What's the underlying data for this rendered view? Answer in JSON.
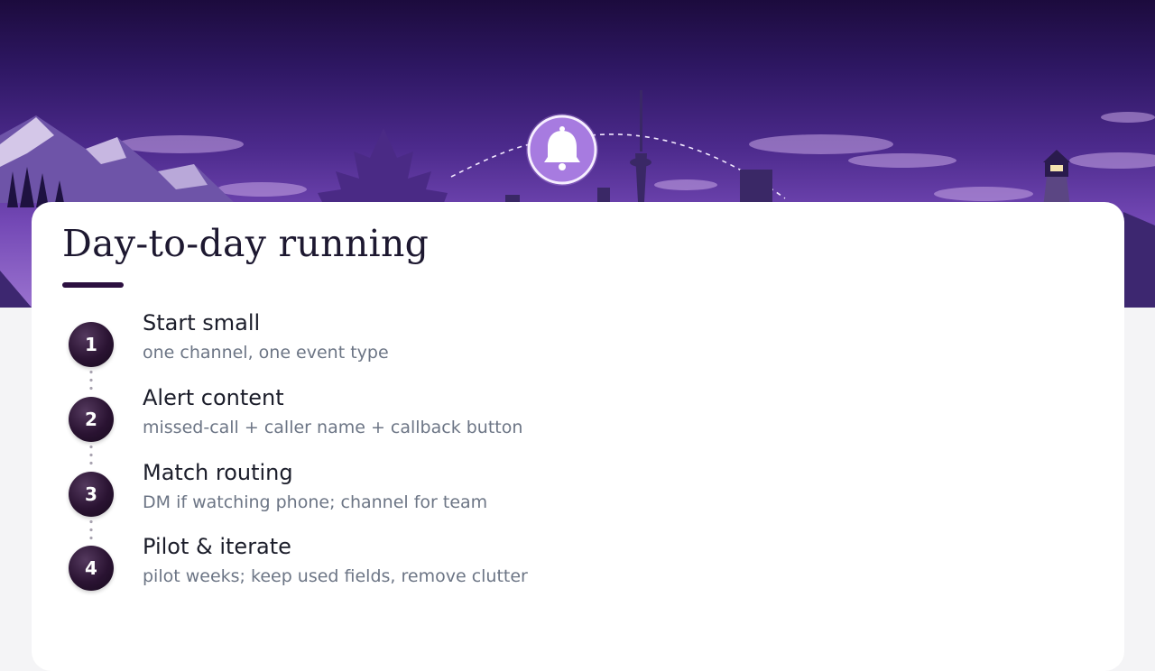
{
  "slide": {
    "title": "Day-to-day running",
    "steps": [
      {
        "number": "1",
        "title": "Start small",
        "desc": "one channel, one event type"
      },
      {
        "number": "2",
        "title": "Alert content",
        "desc": "missed-call + caller name + callback button"
      },
      {
        "number": "3",
        "title": "Match routing",
        "desc": "DM if watching phone; channel for team"
      },
      {
        "number": "4",
        "title": "Pilot & iterate",
        "desc": "pilot weeks; keep used fields, remove clutter"
      }
    ]
  },
  "hero": {
    "icon": "bell-icon",
    "colors": {
      "sky_top": "#1c0b3d",
      "sky_bottom": "#9a72cf",
      "accent": "#2c1040"
    }
  }
}
